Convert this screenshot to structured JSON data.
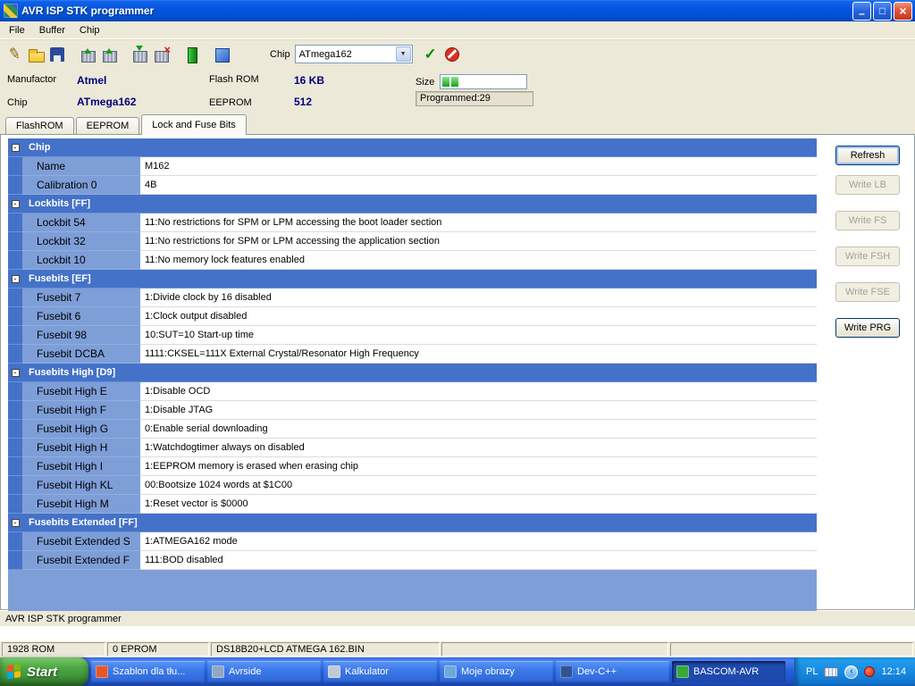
{
  "window": {
    "title": "AVR ISP STK programmer",
    "menu": [
      "File",
      "Buffer",
      "Chip"
    ]
  },
  "toolbar": {
    "icon_groups": [
      [
        "pencil",
        "open-file",
        "save-file"
      ],
      [
        "write-flash",
        "write-eeprom"
      ],
      [
        "read-flash",
        "erase-device"
      ],
      [
        "green-buffer"
      ],
      [
        "device-blue"
      ]
    ],
    "icons_right": [
      "auto-program",
      "cancel"
    ],
    "chip_label": "Chip",
    "chip_value": "ATmega162"
  },
  "info": {
    "manufactor_label": "Manufactor",
    "manufactor_value": "Atmel",
    "chip_label": "Chip",
    "chip_value": "ATmega162",
    "flash_label": "Flash ROM",
    "flash_value": "16 KB",
    "eeprom_label": "EEPROM",
    "eeprom_value": "512",
    "size_label": "Size",
    "programmed": "Programmed:29",
    "progress_segments": 2
  },
  "tabs": [
    {
      "label": "FlashROM",
      "active": false
    },
    {
      "label": "EEPROM",
      "active": false
    },
    {
      "label": "Lock and Fuse Bits",
      "active": true
    }
  ],
  "grid": {
    "sections": [
      {
        "title": "Chip",
        "rows": [
          {
            "label": "Name",
            "value": "M162"
          },
          {
            "label": "Calibration 0",
            "value": "4B"
          }
        ]
      },
      {
        "title": "Lockbits [FF]",
        "rows": [
          {
            "label": "Lockbit 54",
            "value": "11:No restrictions for SPM or LPM accessing the boot loader section"
          },
          {
            "label": "Lockbit 32",
            "value": "11:No restrictions for SPM or LPM accessing the application section"
          },
          {
            "label": "Lockbit 10",
            "value": "11:No memory lock features enabled"
          }
        ]
      },
      {
        "title": "Fusebits [EF]",
        "rows": [
          {
            "label": "Fusebit 7",
            "value": "1:Divide clock by 16 disabled"
          },
          {
            "label": "Fusebit 6",
            "value": "1:Clock output disabled"
          },
          {
            "label": "Fusebit 98",
            "value": "10:SUT=10 Start-up time"
          },
          {
            "label": "Fusebit DCBA",
            "value": "1111:CKSEL=111X External Crystal/Resonator High Frequency"
          }
        ]
      },
      {
        "title": "Fusebits High [D9]",
        "rows": [
          {
            "label": "Fusebit High E",
            "value": "1:Disable OCD"
          },
          {
            "label": "Fusebit High F",
            "value": "1:Disable JTAG"
          },
          {
            "label": "Fusebit High G",
            "value": "0:Enable serial downloading"
          },
          {
            "label": "Fusebit High H",
            "value": "1:Watchdogtimer always on disabled"
          },
          {
            "label": "Fusebit High I",
            "value": "1:EEPROM memory is erased when erasing chip"
          },
          {
            "label": "Fusebit High KL",
            "value": "00:Bootsize 1024 words at $1C00"
          },
          {
            "label": "Fusebit High M",
            "value": "1:Reset vector is $0000"
          }
        ]
      },
      {
        "title": "Fusebits Extended [FF]",
        "rows": [
          {
            "label": "Fusebit Extended S",
            "value": "1:ATMEGA162 mode"
          },
          {
            "label": "Fusebit Extended F",
            "value": "111:BOD disabled"
          }
        ]
      }
    ]
  },
  "side_buttons": [
    {
      "label": "Refresh",
      "enabled": true,
      "focused": true
    },
    {
      "label": "Write LB",
      "enabled": false,
      "focused": false
    },
    {
      "label": "Write FS",
      "enabled": false,
      "focused": false
    },
    {
      "label": "Write FSH",
      "enabled": false,
      "focused": false
    },
    {
      "label": "Write FSE",
      "enabled": false,
      "focused": false
    },
    {
      "label": "Write PRG",
      "enabled": true,
      "focused": false
    }
  ],
  "statusbar": {
    "app_status": "AVR ISP STK programmer"
  },
  "statusbar2": {
    "panels": [
      "1928 ROM",
      "0 EPROM",
      "DS18B20+LCD ATMEGA 162.BIN",
      "",
      ""
    ]
  },
  "taskbar": {
    "start_label": "Start",
    "tasks": [
      {
        "label": "Szablon dla tłu...",
        "icon": "document",
        "icon_color": "#E4572E",
        "active": false
      },
      {
        "label": "Avrside",
        "icon": "avrside",
        "icon_color": "#8FA8C8",
        "active": false
      },
      {
        "label": "Kalkulator",
        "icon": "calculator",
        "icon_color": "#C2C9D6",
        "active": false
      },
      {
        "label": "Moje obrazy",
        "icon": "my-pictures",
        "icon_color": "#6FA8DC",
        "active": false
      },
      {
        "label": "Dev-C++",
        "icon": "devcpp",
        "icon_color": "#2F5496",
        "active": false
      },
      {
        "label": "BASCOM-AVR",
        "icon": "bascom",
        "icon_color": "#3AA63A",
        "active": true
      }
    ],
    "tray": {
      "lang": "PL",
      "time": "12:14"
    }
  },
  "colors": {
    "section_header_blue": "#4472C8",
    "row_label_blue": "#7E9ED8",
    "info_value_navy": "#00007D",
    "taskbar_blue": "#2560DC",
    "start_green": "#3B8C34",
    "progress_green": "#18A018"
  }
}
